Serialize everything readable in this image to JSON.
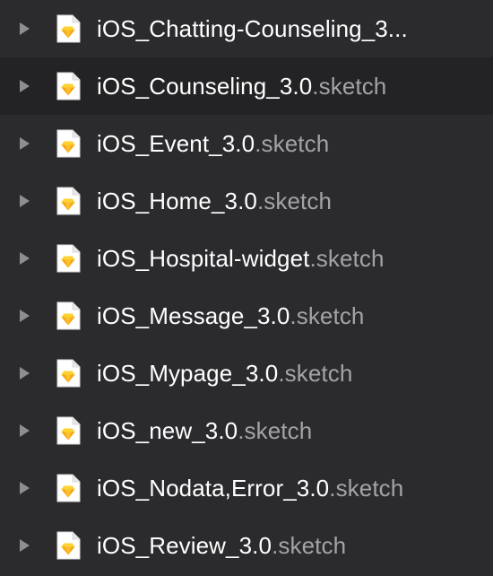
{
  "colors": {
    "background": "#2b2b2e",
    "selected_row": "#232325",
    "filename": "#ffffff",
    "extension": "#a3a3a8",
    "disclosure": "#8e8e92",
    "sketch_diamond_top": "#fdd231",
    "sketch_diamond_bottom": "#f7a612"
  },
  "files": [
    {
      "name": "iOS_Chatting-Counseling_3...",
      "ext": "",
      "icon": "sketch-file-icon",
      "expand_icon": "disclosure-triangle-icon",
      "selected": false
    },
    {
      "name": "iOS_Counseling_3.0",
      "ext": ".sketch",
      "icon": "sketch-file-icon",
      "expand_icon": "disclosure-triangle-icon",
      "selected": true
    },
    {
      "name": "iOS_Event_3.0",
      "ext": ".sketch",
      "icon": "sketch-file-icon",
      "expand_icon": "disclosure-triangle-icon",
      "selected": false
    },
    {
      "name": "iOS_Home_3.0",
      "ext": ".sketch",
      "icon": "sketch-file-icon",
      "expand_icon": "disclosure-triangle-icon",
      "selected": false
    },
    {
      "name": "iOS_Hospital-widget",
      "ext": ".sketch",
      "icon": "sketch-file-icon",
      "expand_icon": "disclosure-triangle-icon",
      "selected": false
    },
    {
      "name": "iOS_Message_3.0",
      "ext": ".sketch",
      "icon": "sketch-file-icon",
      "expand_icon": "disclosure-triangle-icon",
      "selected": false
    },
    {
      "name": "iOS_Mypage_3.0",
      "ext": ".sketch",
      "icon": "sketch-file-icon",
      "expand_icon": "disclosure-triangle-icon",
      "selected": false
    },
    {
      "name": "iOS_new_3.0",
      "ext": ".sketch",
      "icon": "sketch-file-icon",
      "expand_icon": "disclosure-triangle-icon",
      "selected": false
    },
    {
      "name": "iOS_Nodata,Error_3.0",
      "ext": ".sketch",
      "icon": "sketch-file-icon",
      "expand_icon": "disclosure-triangle-icon",
      "selected": false
    },
    {
      "name": "iOS_Review_3.0",
      "ext": ".sketch",
      "icon": "sketch-file-icon",
      "expand_icon": "disclosure-triangle-icon",
      "selected": false
    }
  ]
}
